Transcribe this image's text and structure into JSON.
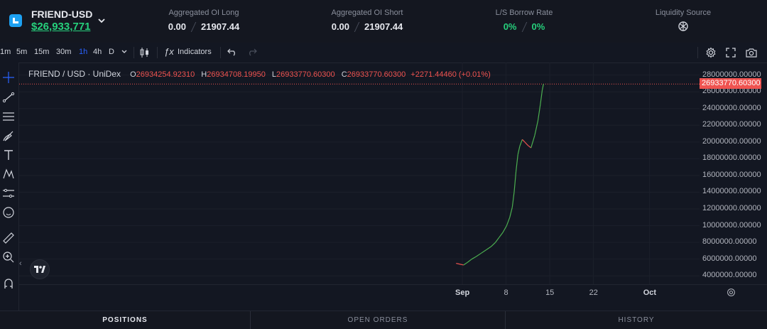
{
  "header": {
    "pair": "FRIEND-USD",
    "price": "$26,933,771",
    "oi_long": {
      "label": "Aggregated OI Long",
      "left": "0.00",
      "right": "21907.44"
    },
    "oi_short": {
      "label": "Aggregated OI Short",
      "left": "0.00",
      "right": "21907.44"
    },
    "borrow": {
      "label": "L/S Borrow Rate",
      "left": "0%",
      "right": "0%"
    },
    "liquidity": {
      "label": "Liquidity Source"
    }
  },
  "toolbar": {
    "intervals": [
      "1m",
      "5m",
      "15m",
      "30m",
      "1h",
      "4h",
      "D"
    ],
    "active_interval": "1h",
    "indicators_label": "Indicators"
  },
  "chart_data": {
    "type": "line",
    "symbol": "FRIEND / USD · UniDex",
    "ohlc": {
      "o_label": "O",
      "open": "26934254.92310",
      "h_label": "H",
      "high": "26934708.19950",
      "l_label": "L",
      "low": "26933770.60300",
      "c_label": "C",
      "close": "26933770.60300",
      "change": "+2271.44460 (+0.01%)"
    },
    "last_price_label": "26933770.60300",
    "last_price": 26933770.603,
    "y_ticks": [
      "28000000.00000",
      "26000000.00000",
      "24000000.00000",
      "22000000.00000",
      "20000000.00000",
      "18000000.00000",
      "16000000.00000",
      "14000000.00000",
      "12000000.00000",
      "10000000.00000",
      "8000000.00000",
      "6000000.00000",
      "4000000.00000"
    ],
    "y_tick_values": [
      28000000,
      26000000,
      24000000,
      22000000,
      20000000,
      18000000,
      16000000,
      14000000,
      12000000,
      10000000,
      8000000,
      6000000,
      4000000
    ],
    "ylim": [
      3000000,
      29500000
    ],
    "x_ticks": [
      {
        "label": "Sep",
        "day": 1,
        "bold": true
      },
      {
        "label": "8",
        "day": 8,
        "bold": false
      },
      {
        "label": "15",
        "day": 15,
        "bold": false
      },
      {
        "label": "22",
        "day": 22,
        "bold": false
      },
      {
        "label": "Oct",
        "day": 31,
        "bold": true
      }
    ],
    "xlim_days": [
      -70,
      39
    ],
    "series": [
      {
        "up_color": "#4caf50",
        "down_color": "#ef5350",
        "points": [
          [
            0.0,
            5500000
          ],
          [
            0.6,
            5400000
          ],
          [
            1.2,
            5300000
          ],
          [
            1.8,
            5600000
          ],
          [
            2.5,
            6000000
          ],
          [
            3.2,
            6300000
          ],
          [
            4.0,
            6700000
          ],
          [
            4.8,
            7100000
          ],
          [
            5.6,
            7500000
          ],
          [
            6.3,
            8000000
          ],
          [
            6.9,
            8600000
          ],
          [
            7.5,
            9200000
          ],
          [
            8.1,
            10000000
          ],
          [
            8.6,
            11000000
          ],
          [
            9.0,
            12200000
          ],
          [
            9.3,
            14000000
          ],
          [
            9.6,
            16500000
          ],
          [
            9.9,
            18500000
          ],
          [
            10.2,
            19500000
          ],
          [
            10.6,
            20300000
          ],
          [
            11.0,
            20000000
          ],
          [
            11.5,
            19600000
          ],
          [
            12.0,
            19300000
          ],
          [
            12.6,
            20800000
          ],
          [
            13.1,
            22500000
          ],
          [
            13.5,
            24500000
          ],
          [
            13.8,
            26200000
          ],
          [
            14.0,
            26933770
          ]
        ]
      }
    ]
  },
  "tabs": [
    "POSITIONS",
    "OPEN ORDERS",
    "HISTORY"
  ],
  "active_tab": "POSITIONS"
}
